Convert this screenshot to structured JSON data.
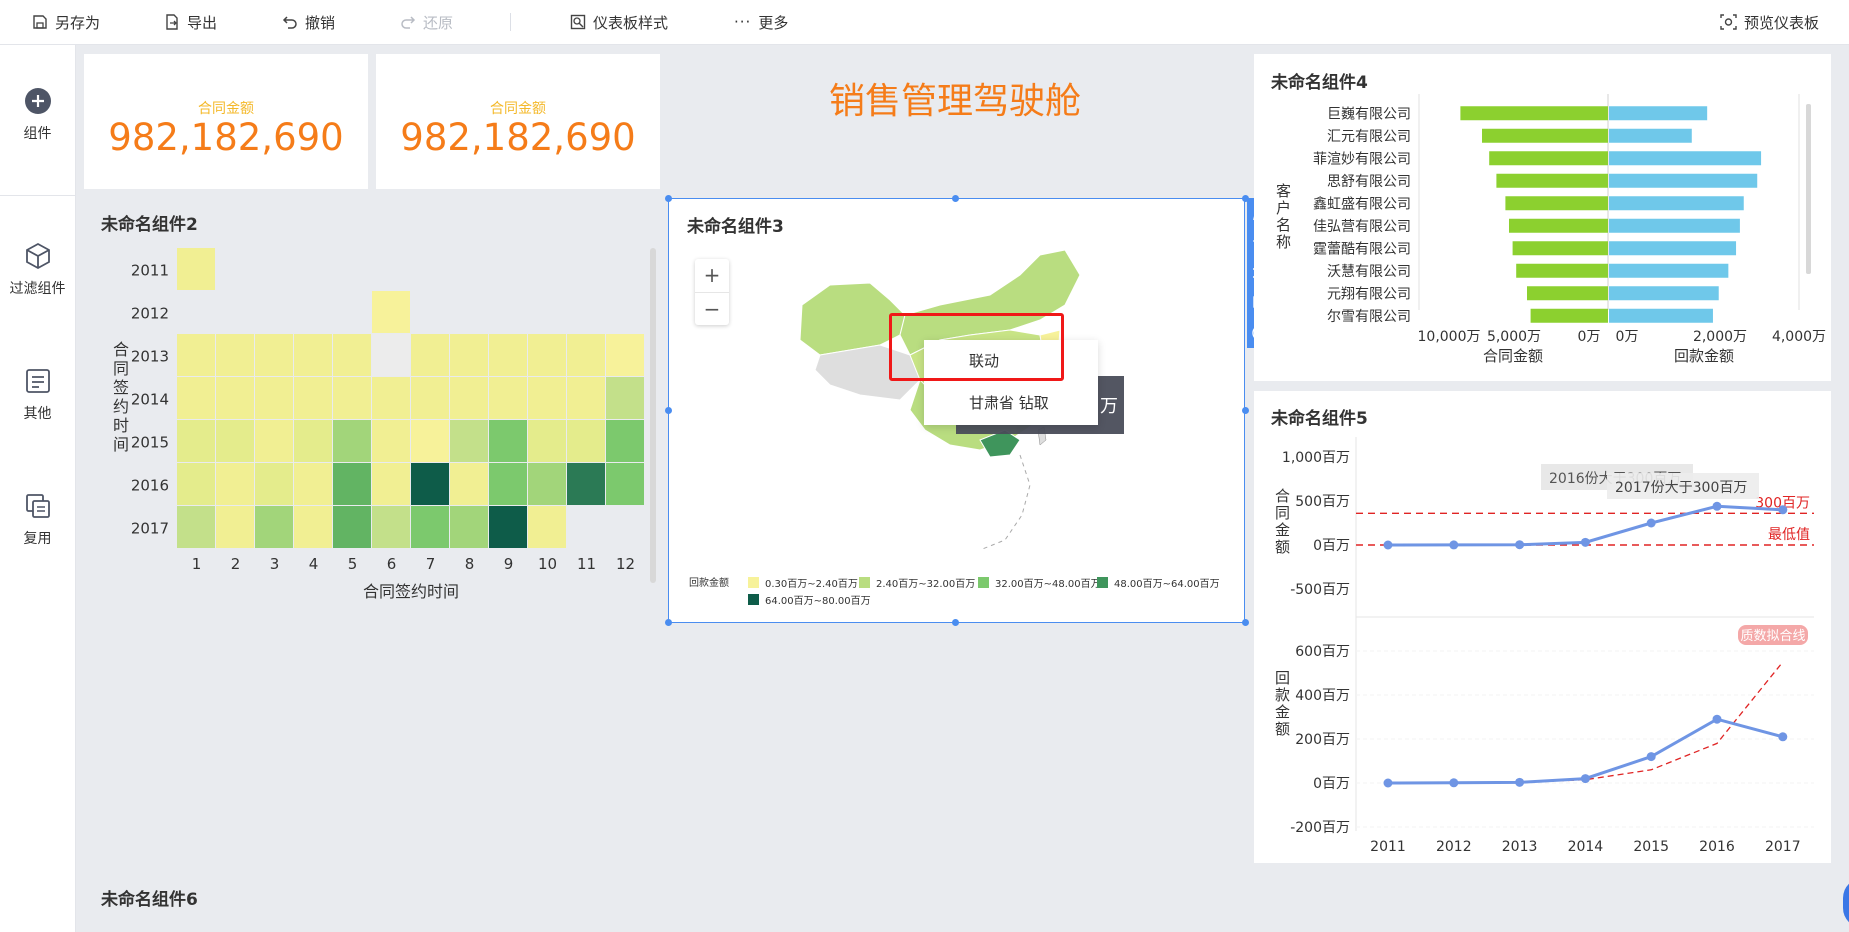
{
  "toolbar": {
    "save_as": "另存为",
    "export": "导出",
    "undo": "撤销",
    "redo": "还原",
    "dashboard_style": "仪表板样式",
    "more": "更多",
    "preview": "预览仪表板"
  },
  "sidebar": {
    "items": [
      {
        "label": "组件",
        "icon": "plus-circle-icon"
      },
      {
        "label": "过滤组件",
        "icon": "cube-icon"
      },
      {
        "label": "其他",
        "icon": "document-icon"
      },
      {
        "label": "复用",
        "icon": "copy-icon"
      }
    ]
  },
  "kpis": [
    {
      "label": "合同金额",
      "value": "982,182,690"
    },
    {
      "label": "合同金额",
      "value": "982,182,690"
    }
  ],
  "dashboard_title": "销售管理驾驶舱",
  "widgets": {
    "w2": {
      "title": "未命名组件2"
    },
    "w3": {
      "title": "未命名组件3"
    },
    "w4": {
      "title": "未命名组件4"
    },
    "w5": {
      "title": "未命名组件5"
    },
    "w6": {
      "title": "未命名组件6"
    }
  },
  "map": {
    "zoom_in": "+",
    "zoom_out": "−",
    "context_menu": [
      "联动",
      "甘肃省 钻取"
    ],
    "tooltip_fragment": "万",
    "legend_title": "回款金额",
    "legend": [
      {
        "label": "0.30百万~2.40百万",
        "color": "#f7f29a"
      },
      {
        "label": "2.40百万~32.00百万",
        "color": "#b9dd80"
      },
      {
        "label": "32.00百万~48.00百万",
        "color": "#7cc96d"
      },
      {
        "label": "48.00百万~64.00百万",
        "color": "#3f955c"
      },
      {
        "label": "64.00百万~80.00百万",
        "color": "#0e5c49"
      }
    ]
  },
  "chart_data": [
    {
      "type": "heatmap",
      "widget": "未命名组件2",
      "xlabel": "合同签约时间",
      "ylabel": "合同签约时间",
      "x": [
        1,
        2,
        3,
        4,
        5,
        6,
        7,
        8,
        9,
        10,
        11,
        12
      ],
      "y": [
        "2011",
        "2012",
        "2013",
        "2014",
        "2015",
        "2016",
        "2017"
      ],
      "level_colors": [
        "#f7f29a",
        "#f1ef93",
        "#e4ec8c",
        "#c3e08a",
        "#a2d57a",
        "#7cc96d",
        "#62b463",
        "#3f955c",
        "#2b7a55",
        "#0e5c49"
      ],
      "cells": [
        [
          1,
          null,
          null,
          null,
          null,
          null,
          null,
          null,
          null,
          null,
          null,
          null
        ],
        [
          null,
          null,
          null,
          null,
          null,
          0,
          null,
          null,
          null,
          null,
          null,
          null
        ],
        [
          1,
          1,
          1,
          1,
          1,
          null,
          1,
          1,
          1,
          1,
          1,
          0
        ],
        [
          1,
          1,
          1,
          1,
          1,
          1,
          1,
          1,
          1,
          1,
          1,
          3
        ],
        [
          2,
          2,
          1,
          2,
          4,
          1,
          0,
          3,
          5,
          2,
          2,
          5
        ],
        [
          2,
          1,
          2,
          1,
          6,
          1,
          9,
          1,
          5,
          4,
          8,
          5
        ],
        [
          3,
          1,
          4,
          1,
          6,
          3,
          5,
          4,
          9,
          1,
          null,
          null
        ]
      ]
    },
    {
      "type": "bar",
      "widget": "未命名组件4",
      "ylabel": "客户名称",
      "categories": [
        "巨巍有限公司",
        "汇元有限公司",
        "菲渲妙有限公司",
        "思舒有限公司",
        "鑫虹盛有限公司",
        "佳弘营有限公司",
        "霆蕾酷有限公司",
        "沃慧有限公司",
        "元翔有限公司",
        "尔雪有限公司"
      ],
      "series": [
        {
          "name": "合同金额",
          "xlabel": "合同金额",
          "values": [
            8200,
            7000,
            6600,
            6200,
            5700,
            5500,
            5300,
            5100,
            4500,
            4300
          ],
          "xlim": [
            0,
            12000
          ],
          "color": "#8cd02f"
        },
        {
          "name": "回款金额",
          "xlabel": "回款金额",
          "values": [
            2550,
            2150,
            3950,
            3850,
            3500,
            3400,
            3300,
            3100,
            2850,
            2700
          ],
          "xlim": [
            0,
            4500
          ],
          "color": "#6fc8ea"
        }
      ],
      "left_ticks": [
        "10,000万",
        "5,000万",
        "0万"
      ],
      "right_ticks": [
        "0万",
        "2,000万",
        "4,000万"
      ]
    },
    {
      "type": "line",
      "widget": "未命名组件5",
      "xlabel": "合同签约时间",
      "x": [
        "2011",
        "2012",
        "2013",
        "2014",
        "2015",
        "2016",
        "2017"
      ],
      "panels": [
        {
          "ylabel": "合同金额",
          "yticks": [
            "1,000百万",
            "500百万",
            "0百万",
            "-500百万"
          ],
          "ylim": [
            -600,
            1050
          ],
          "values": [
            0,
            1,
            3,
            30,
            250,
            440,
            400
          ],
          "reference_lines": [
            {
              "label": "300百万",
              "value": 360
            },
            {
              "label": "最低值",
              "value": 0
            }
          ],
          "annotations": [
            "2016份大于300百万",
            "2017份大于300百万"
          ]
        },
        {
          "ylabel": "回款金额",
          "yticks": [
            "600百万",
            "400百万",
            "200百万",
            "0百万",
            "-200百万"
          ],
          "ylim": [
            -240,
            640
          ],
          "values": [
            0,
            1,
            3,
            20,
            120,
            290,
            210
          ],
          "fit_line": {
            "label": "质数拟合线",
            "values": [
              0,
              0,
              2,
              15,
              60,
              180,
              550
            ]
          }
        }
      ],
      "line_color": "#6f95e4",
      "ref_color": "#e02424"
    }
  ]
}
